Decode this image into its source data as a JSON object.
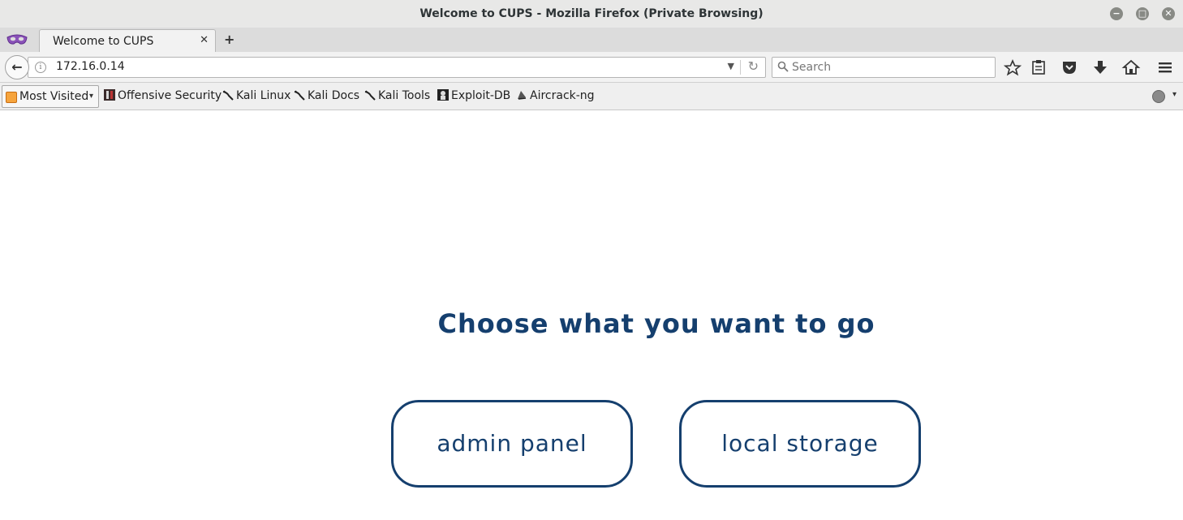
{
  "window": {
    "title": "Welcome to CUPS - Mozilla Firefox (Private Browsing)",
    "controls": {
      "minimize": "−",
      "maximize": "□",
      "close": "✕"
    }
  },
  "tabs": {
    "active": {
      "title": "Welcome to CUPS",
      "close": "✕"
    },
    "new_tab": "+"
  },
  "navbar": {
    "back": "←",
    "url": "172.16.0.14",
    "url_dropdown": "▼",
    "reload": "↻",
    "search_placeholder": "Search",
    "icons": [
      "bookmark-star-icon",
      "reading-list-icon",
      "pocket-icon",
      "download-icon",
      "home-icon",
      "menu-icon"
    ]
  },
  "bookmarks": {
    "most_visited": "Most Visited",
    "caret": "▾",
    "items": [
      {
        "label": "Offensive Security",
        "icon": "offsec-icon"
      },
      {
        "label": "Kali Linux",
        "icon": "kali-icon"
      },
      {
        "label": "Kali Docs",
        "icon": "kali-icon"
      },
      {
        "label": "Kali Tools",
        "icon": "kali-icon"
      },
      {
        "label": "Exploit-DB",
        "icon": "exploitdb-icon"
      },
      {
        "label": "Aircrack-ng",
        "icon": "aircrack-icon"
      }
    ]
  },
  "page": {
    "heading": "Choose what you want to go",
    "buttons": {
      "admin": "admin panel",
      "storage": "local storage"
    }
  },
  "colors": {
    "accent": "#153f6e"
  }
}
